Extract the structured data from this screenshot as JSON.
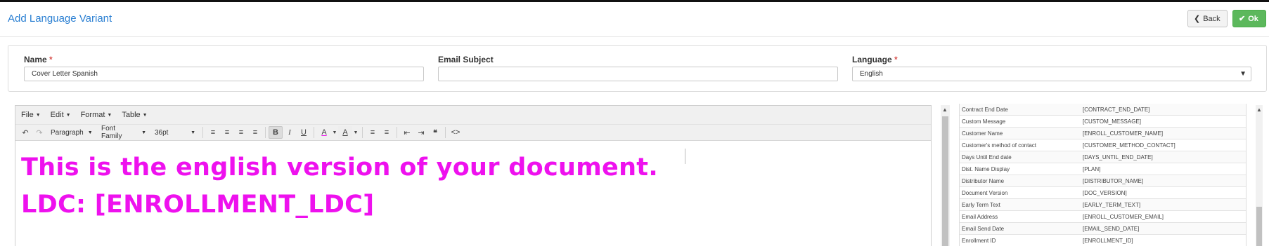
{
  "header": {
    "title": "Add Language Variant",
    "back_label": "Back",
    "ok_label": "Ok"
  },
  "form": {
    "name_label": "Name",
    "name_value": "Cover Letter Spanish",
    "subject_label": "Email Subject",
    "subject_value": "",
    "language_label": "Language",
    "language_value": "English",
    "required_marker": "*"
  },
  "editor": {
    "menus": [
      "File",
      "Edit",
      "Format",
      "Table"
    ],
    "block_format": "Paragraph",
    "font_family": "Font Family",
    "font_size": "36pt",
    "content_lines": [
      "This is the english version of your document.",
      "LDC: [ENROLLMENT_LDC]"
    ],
    "content_color": "#ee11ee"
  },
  "merge_fields": [
    {
      "name": "Contract End Date",
      "code": "[CONTRACT_END_DATE]"
    },
    {
      "name": "Custom Message",
      "code": "[CUSTOM_MESSAGE]"
    },
    {
      "name": "Customer Name",
      "code": "[ENROLL_CUSTOMER_NAME]"
    },
    {
      "name": "Customer's method of contact",
      "code": "[CUSTOMER_METHOD_CONTACT]"
    },
    {
      "name": "Days Until End date",
      "code": "[DAYS_UNTIL_END_DATE]"
    },
    {
      "name": "Dist. Name Display",
      "code": "[PLAN]"
    },
    {
      "name": "Distributor Name",
      "code": "[DISTRIBUTOR_NAME]"
    },
    {
      "name": "Document Version",
      "code": "[DOC_VERSION]"
    },
    {
      "name": "Early Term Text",
      "code": "[EARLY_TERM_TEXT]"
    },
    {
      "name": "Email Address",
      "code": "[ENROLL_CUSTOMER_EMAIL]"
    },
    {
      "name": "Email Send Date",
      "code": "[EMAIL_SEND_DATE]"
    },
    {
      "name": "Enrollment ID",
      "code": "[ENROLLMENT_ID]"
    }
  ],
  "colors": {
    "accent": "#2a7fd2",
    "ok": "#5cb85c",
    "required": "#d9534f"
  }
}
